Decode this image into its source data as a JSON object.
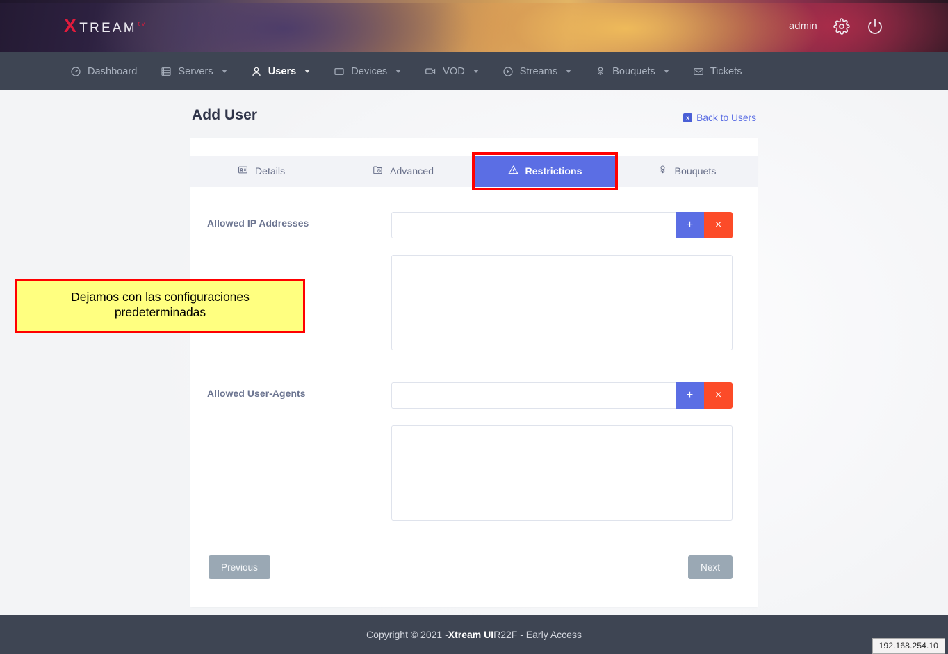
{
  "brand": {
    "logo_x": "X",
    "logo_rest": "TREAM",
    "logo_tm": "tv"
  },
  "header": {
    "user": "admin",
    "settings_icon": "gear-icon",
    "power_icon": "power-icon"
  },
  "nav": {
    "items": [
      {
        "label": "Dashboard",
        "icon": "dashboard-icon",
        "caret": false,
        "active": false
      },
      {
        "label": "Servers",
        "icon": "server-icon",
        "caret": true,
        "active": false
      },
      {
        "label": "Users",
        "icon": "user-icon",
        "caret": true,
        "active": true
      },
      {
        "label": "Devices",
        "icon": "device-icon",
        "caret": true,
        "active": false
      },
      {
        "label": "VOD",
        "icon": "video-icon",
        "caret": true,
        "active": false
      },
      {
        "label": "Streams",
        "icon": "play-circle-icon",
        "caret": true,
        "active": false
      },
      {
        "label": "Bouquets",
        "icon": "bouquet-icon",
        "caret": true,
        "active": false
      },
      {
        "label": "Tickets",
        "icon": "mail-icon",
        "caret": false,
        "active": false
      }
    ]
  },
  "page": {
    "title": "Add User",
    "back_link": "Back to Users",
    "back_badge": "x"
  },
  "tabs": [
    {
      "label": "Details",
      "icon": "id-card-icon",
      "active": false
    },
    {
      "label": "Advanced",
      "icon": "folder-clock-icon",
      "active": false
    },
    {
      "label": "Restrictions",
      "icon": "warning-triangle-icon",
      "active": true
    },
    {
      "label": "Bouquets",
      "icon": "bouquet-icon",
      "active": false
    }
  ],
  "form": {
    "allowed_ip": {
      "label": "Allowed IP Addresses",
      "value": "",
      "placeholder": "",
      "add_label": "+",
      "remove_label": "×"
    },
    "allowed_user_agents": {
      "label": "Allowed User-Agents",
      "value": "",
      "placeholder": "",
      "add_label": "+",
      "remove_label": "×"
    }
  },
  "actions": {
    "previous": "Previous",
    "next": "Next"
  },
  "annotation": {
    "text": "Dejamos con las configuraciones predeterminadas",
    "fill_color": "#ffff80",
    "border_color": "#ff0000"
  },
  "footer": {
    "copyright_prefix": "Copyright © 2021 - ",
    "product": "Xtream UI",
    "copyright_suffix": " R22F - Early Access"
  },
  "status_chip": {
    "text": "192.168.254.10"
  },
  "colors": {
    "accent_blue": "#5b6ee4",
    "danger_red": "#fc4b28",
    "nav_dark": "#3e4553",
    "page_bg": "#f3f4f6",
    "muted_button": "#9aa8b4"
  }
}
